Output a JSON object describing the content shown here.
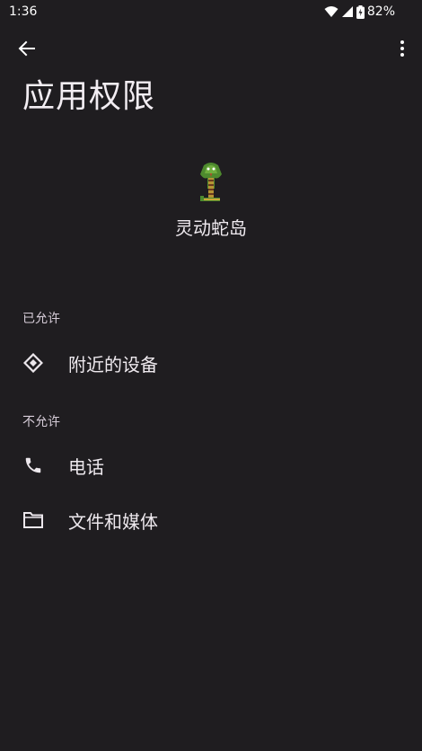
{
  "status_bar": {
    "time": "1:36",
    "battery": "82%",
    "icons": [
      "wifi-icon",
      "signal-icon",
      "battery-charging-icon"
    ]
  },
  "app_bar": {
    "back_icon": "arrow-back-icon",
    "more_icon": "more-vert-icon",
    "title": "应用权限"
  },
  "app": {
    "icon": "snake-app-icon",
    "name": "灵动蛇岛"
  },
  "sections": {
    "allowed": {
      "header": "已允许",
      "items": [
        {
          "icon": "nearby-devices-icon",
          "label": "附近的设备"
        }
      ]
    },
    "not_allowed": {
      "header": "不允许",
      "items": [
        {
          "icon": "phone-icon",
          "label": "电话"
        },
        {
          "icon": "folder-icon",
          "label": "文件和媒体"
        }
      ]
    }
  },
  "colors": {
    "background": "#1f1d20",
    "text_primary": "#eee9ee",
    "text_secondary": "#d7cdd9"
  }
}
